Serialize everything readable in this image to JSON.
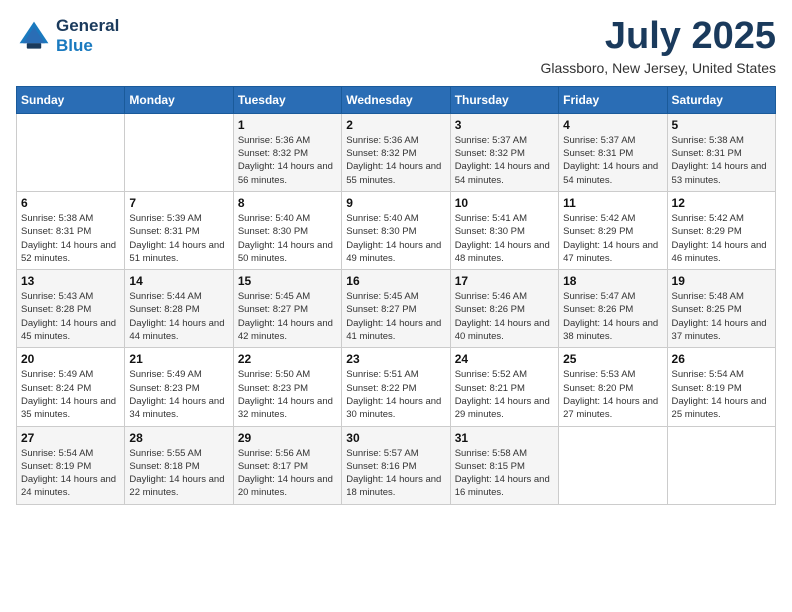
{
  "header": {
    "logo_line1": "General",
    "logo_line2": "Blue",
    "month_title": "July 2025",
    "location": "Glassboro, New Jersey, United States"
  },
  "days_of_week": [
    "Sunday",
    "Monday",
    "Tuesday",
    "Wednesday",
    "Thursday",
    "Friday",
    "Saturday"
  ],
  "weeks": [
    [
      {
        "num": "",
        "info": ""
      },
      {
        "num": "",
        "info": ""
      },
      {
        "num": "1",
        "info": "Sunrise: 5:36 AM\nSunset: 8:32 PM\nDaylight: 14 hours and 56 minutes."
      },
      {
        "num": "2",
        "info": "Sunrise: 5:36 AM\nSunset: 8:32 PM\nDaylight: 14 hours and 55 minutes."
      },
      {
        "num": "3",
        "info": "Sunrise: 5:37 AM\nSunset: 8:32 PM\nDaylight: 14 hours and 54 minutes."
      },
      {
        "num": "4",
        "info": "Sunrise: 5:37 AM\nSunset: 8:31 PM\nDaylight: 14 hours and 54 minutes."
      },
      {
        "num": "5",
        "info": "Sunrise: 5:38 AM\nSunset: 8:31 PM\nDaylight: 14 hours and 53 minutes."
      }
    ],
    [
      {
        "num": "6",
        "info": "Sunrise: 5:38 AM\nSunset: 8:31 PM\nDaylight: 14 hours and 52 minutes."
      },
      {
        "num": "7",
        "info": "Sunrise: 5:39 AM\nSunset: 8:31 PM\nDaylight: 14 hours and 51 minutes."
      },
      {
        "num": "8",
        "info": "Sunrise: 5:40 AM\nSunset: 8:30 PM\nDaylight: 14 hours and 50 minutes."
      },
      {
        "num": "9",
        "info": "Sunrise: 5:40 AM\nSunset: 8:30 PM\nDaylight: 14 hours and 49 minutes."
      },
      {
        "num": "10",
        "info": "Sunrise: 5:41 AM\nSunset: 8:30 PM\nDaylight: 14 hours and 48 minutes."
      },
      {
        "num": "11",
        "info": "Sunrise: 5:42 AM\nSunset: 8:29 PM\nDaylight: 14 hours and 47 minutes."
      },
      {
        "num": "12",
        "info": "Sunrise: 5:42 AM\nSunset: 8:29 PM\nDaylight: 14 hours and 46 minutes."
      }
    ],
    [
      {
        "num": "13",
        "info": "Sunrise: 5:43 AM\nSunset: 8:28 PM\nDaylight: 14 hours and 45 minutes."
      },
      {
        "num": "14",
        "info": "Sunrise: 5:44 AM\nSunset: 8:28 PM\nDaylight: 14 hours and 44 minutes."
      },
      {
        "num": "15",
        "info": "Sunrise: 5:45 AM\nSunset: 8:27 PM\nDaylight: 14 hours and 42 minutes."
      },
      {
        "num": "16",
        "info": "Sunrise: 5:45 AM\nSunset: 8:27 PM\nDaylight: 14 hours and 41 minutes."
      },
      {
        "num": "17",
        "info": "Sunrise: 5:46 AM\nSunset: 8:26 PM\nDaylight: 14 hours and 40 minutes."
      },
      {
        "num": "18",
        "info": "Sunrise: 5:47 AM\nSunset: 8:26 PM\nDaylight: 14 hours and 38 minutes."
      },
      {
        "num": "19",
        "info": "Sunrise: 5:48 AM\nSunset: 8:25 PM\nDaylight: 14 hours and 37 minutes."
      }
    ],
    [
      {
        "num": "20",
        "info": "Sunrise: 5:49 AM\nSunset: 8:24 PM\nDaylight: 14 hours and 35 minutes."
      },
      {
        "num": "21",
        "info": "Sunrise: 5:49 AM\nSunset: 8:23 PM\nDaylight: 14 hours and 34 minutes."
      },
      {
        "num": "22",
        "info": "Sunrise: 5:50 AM\nSunset: 8:23 PM\nDaylight: 14 hours and 32 minutes."
      },
      {
        "num": "23",
        "info": "Sunrise: 5:51 AM\nSunset: 8:22 PM\nDaylight: 14 hours and 30 minutes."
      },
      {
        "num": "24",
        "info": "Sunrise: 5:52 AM\nSunset: 8:21 PM\nDaylight: 14 hours and 29 minutes."
      },
      {
        "num": "25",
        "info": "Sunrise: 5:53 AM\nSunset: 8:20 PM\nDaylight: 14 hours and 27 minutes."
      },
      {
        "num": "26",
        "info": "Sunrise: 5:54 AM\nSunset: 8:19 PM\nDaylight: 14 hours and 25 minutes."
      }
    ],
    [
      {
        "num": "27",
        "info": "Sunrise: 5:54 AM\nSunset: 8:19 PM\nDaylight: 14 hours and 24 minutes."
      },
      {
        "num": "28",
        "info": "Sunrise: 5:55 AM\nSunset: 8:18 PM\nDaylight: 14 hours and 22 minutes."
      },
      {
        "num": "29",
        "info": "Sunrise: 5:56 AM\nSunset: 8:17 PM\nDaylight: 14 hours and 20 minutes."
      },
      {
        "num": "30",
        "info": "Sunrise: 5:57 AM\nSunset: 8:16 PM\nDaylight: 14 hours and 18 minutes."
      },
      {
        "num": "31",
        "info": "Sunrise: 5:58 AM\nSunset: 8:15 PM\nDaylight: 14 hours and 16 minutes."
      },
      {
        "num": "",
        "info": ""
      },
      {
        "num": "",
        "info": ""
      }
    ]
  ]
}
